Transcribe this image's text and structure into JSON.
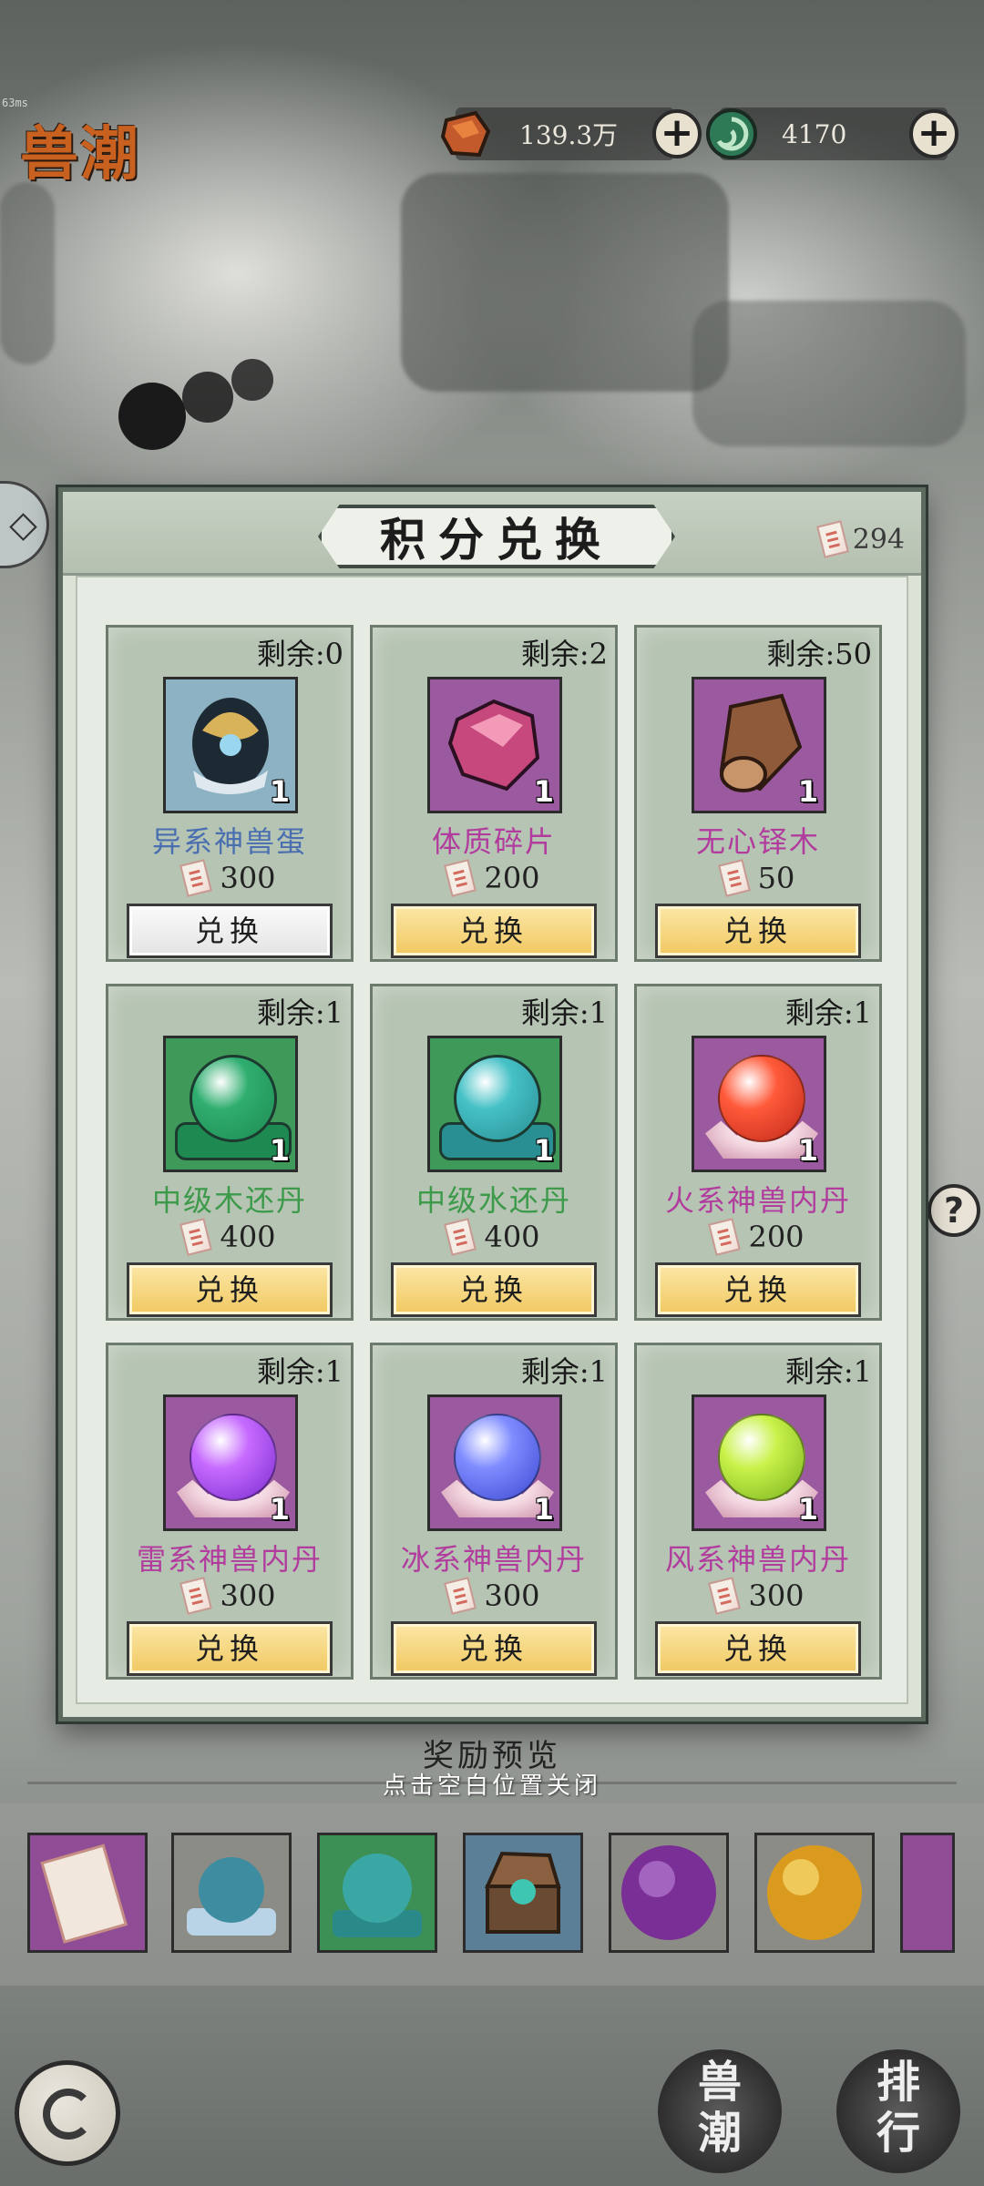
{
  "screen": {
    "fps_text": "63ms",
    "logo_text": "兽潮",
    "currencies": [
      {
        "value": "139.3万",
        "icon": "ore-icon",
        "add_label": "+"
      },
      {
        "value": "4170",
        "icon": "jade-swirl-icon",
        "add_label": "+"
      }
    ],
    "left_tab_label": "◇",
    "help_label": "?"
  },
  "panel": {
    "title": "积分兑换",
    "points_icon": "ticket-icon",
    "points_value": "294",
    "items": [
      {
        "remain": "剩余:0",
        "name": "异系神兽蛋",
        "name_color": "#4a6fb0",
        "icon": "beast-egg-icon",
        "icon_bg": "blue",
        "qty": "1",
        "cost": "300",
        "button": "兑换",
        "disabled": true
      },
      {
        "remain": "剩余:2",
        "name": "体质碎片",
        "name_color": "#b13c9e",
        "icon": "crystal-fragment-icon",
        "icon_bg": "purple",
        "qty": "1",
        "cost": "200",
        "button": "兑换",
        "disabled": false
      },
      {
        "remain": "剩余:50",
        "name": "无心铎木",
        "name_color": "#b13c9e",
        "icon": "wood-log-icon",
        "icon_bg": "purple",
        "qty": "1",
        "cost": "50",
        "button": "兑换",
        "disabled": false
      },
      {
        "remain": "剩余:1",
        "name": "中级木还丹",
        "name_color": "#3c9a4a",
        "icon": "green-elixir-icon",
        "icon_bg": "green",
        "qty": "1",
        "cost": "400",
        "button": "兑换",
        "disabled": false
      },
      {
        "remain": "剩余:1",
        "name": "中级水还丹",
        "name_color": "#3c9a4a",
        "icon": "cyan-elixir-icon",
        "icon_bg": "green",
        "qty": "1",
        "cost": "400",
        "button": "兑换",
        "disabled": false
      },
      {
        "remain": "剩余:1",
        "name": "火系神兽内丹",
        "name_color": "#b13c9e",
        "icon": "fire-core-icon",
        "icon_bg": "purple",
        "qty": "1",
        "cost": "200",
        "button": "兑换",
        "disabled": false
      },
      {
        "remain": "剩余:1",
        "name": "雷系神兽内丹",
        "name_color": "#b13c9e",
        "icon": "thunder-core-icon",
        "icon_bg": "purple",
        "qty": "1",
        "cost": "300",
        "button": "兑换",
        "disabled": false
      },
      {
        "remain": "剩余:1",
        "name": "冰系神兽内丹",
        "name_color": "#b13c9e",
        "icon": "ice-core-icon",
        "icon_bg": "purple",
        "qty": "1",
        "cost": "300",
        "button": "兑换",
        "disabled": false
      },
      {
        "remain": "剩余:1",
        "name": "风系神兽内丹",
        "name_color": "#b13c9e",
        "icon": "wind-core-icon",
        "icon_bg": "purple",
        "qty": "1",
        "cost": "300",
        "button": "兑换",
        "disabled": false
      }
    ]
  },
  "footer": {
    "preview_title": "奖励预览",
    "close_hint": "点击空白位置关闭",
    "preview_items": [
      "ticket-icon",
      "grey-orb-icon",
      "green-elixir-icon",
      "treasure-chest-icon",
      "purple-orb-icon",
      "golden-orb-icon",
      "partial-item-icon"
    ],
    "back_icon": "back-arrow-icon",
    "nav": [
      {
        "label": "兽潮"
      },
      {
        "label": "排行"
      }
    ]
  }
}
